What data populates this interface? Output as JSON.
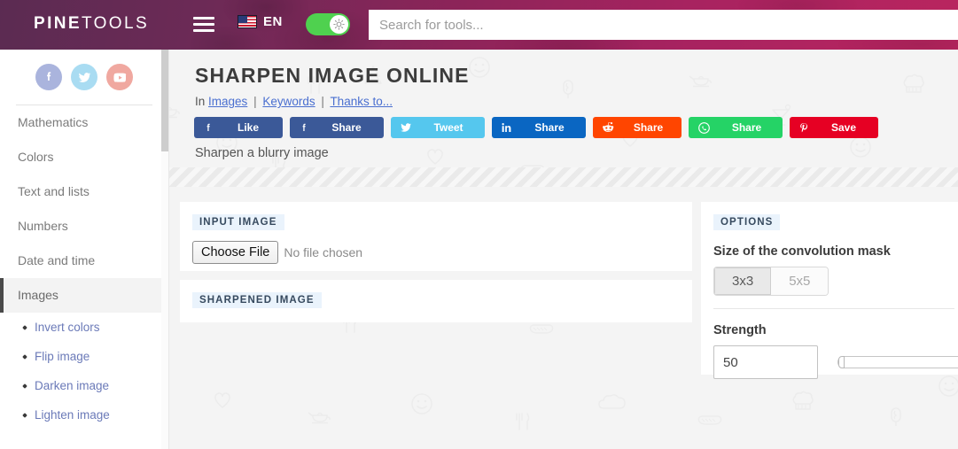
{
  "header": {
    "logo_bold": "PINE",
    "logo_light": "TOOLS",
    "menu_icon": "hamburger-icon",
    "language": "EN",
    "flag_icon": "us-flag-icon",
    "theme_toggle_icon": "sun-icon",
    "search_placeholder": "Search for tools...",
    "search_value": "",
    "gradient_start": "#5b2b52",
    "gradient_end": "#b9255f"
  },
  "sidebar": {
    "social": [
      {
        "name": "facebook",
        "icon": "facebook-icon",
        "color": "#aab4dd"
      },
      {
        "name": "twitter",
        "icon": "twitter-icon",
        "color": "#a9dcf2"
      },
      {
        "name": "youtube",
        "icon": "youtube-icon",
        "color": "#f0a8a0"
      }
    ],
    "categories": [
      {
        "label": "Mathematics",
        "active": false
      },
      {
        "label": "Colors",
        "active": false
      },
      {
        "label": "Text and lists",
        "active": false
      },
      {
        "label": "Numbers",
        "active": false
      },
      {
        "label": "Date and time",
        "active": false
      },
      {
        "label": "Images",
        "active": true
      }
    ],
    "image_tools": [
      {
        "label": "Invert colors"
      },
      {
        "label": "Flip image"
      },
      {
        "label": "Darken image"
      },
      {
        "label": "Lighten image"
      }
    ]
  },
  "main": {
    "title": "SHARPEN IMAGE ONLINE",
    "breadcrumb": {
      "prefix": "In",
      "links": [
        "Images",
        "Keywords",
        "Thanks to..."
      ],
      "separator": "|"
    },
    "subtitle": "Sharpen a blurry image",
    "share_buttons": [
      {
        "label": "Like",
        "network": "facebook",
        "icon": "facebook-icon",
        "color": "#3b5998"
      },
      {
        "label": "Share",
        "network": "facebook",
        "icon": "facebook-icon",
        "color": "#3b5998"
      },
      {
        "label": "Tweet",
        "network": "twitter",
        "icon": "twitter-icon",
        "color": "#55c7ee"
      },
      {
        "label": "Share",
        "network": "linkedin",
        "icon": "linkedin-icon",
        "color": "#0a66c2"
      },
      {
        "label": "Share",
        "network": "reddit",
        "icon": "reddit-icon",
        "color": "#ff4500"
      },
      {
        "label": "Share",
        "network": "whatsapp",
        "icon": "whatsapp-icon",
        "color": "#25d366"
      },
      {
        "label": "Save",
        "network": "pinterest",
        "icon": "pinterest-icon",
        "color": "#e60023"
      }
    ],
    "input_panel": {
      "label": "INPUT IMAGE",
      "choose_file_label": "Choose File",
      "file_status": "No file chosen"
    },
    "output_panel": {
      "label": "SHARPENED IMAGE"
    },
    "options_panel": {
      "label": "OPTIONS",
      "mask_heading": "Size of the convolution mask",
      "mask_options": [
        {
          "label": "3x3",
          "selected": true
        },
        {
          "label": "5x5",
          "selected": false
        }
      ],
      "strength_heading": "Strength",
      "strength_value": "50",
      "strength_min": 0,
      "strength_max": 100
    }
  }
}
